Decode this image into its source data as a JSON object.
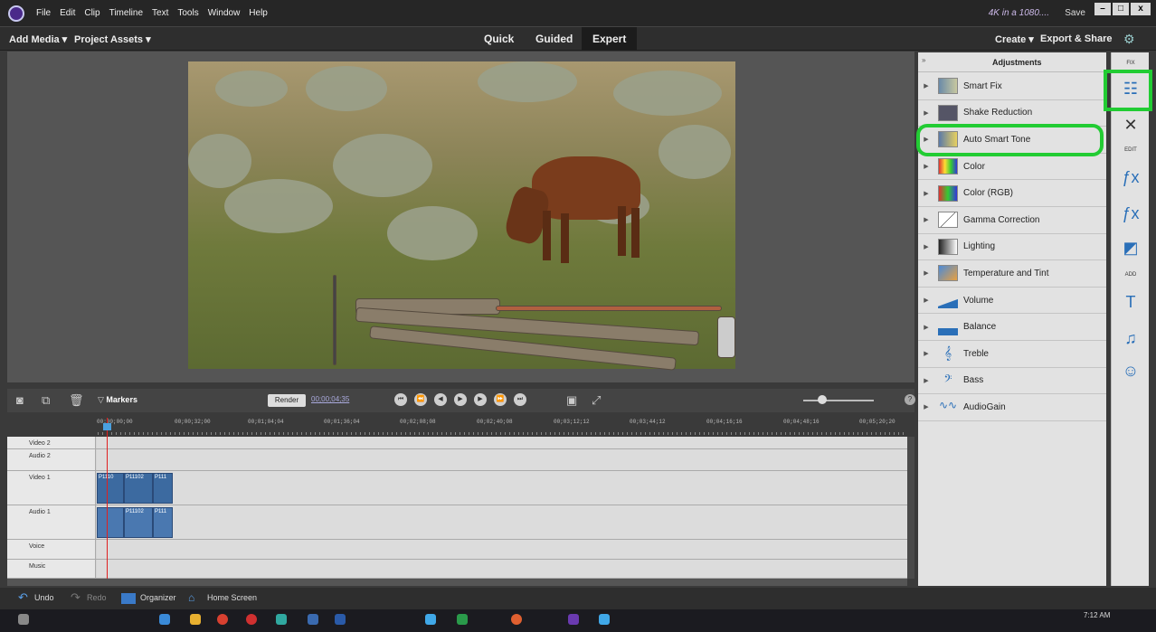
{
  "menubar": {
    "items": [
      "File",
      "Edit",
      "Clip",
      "Timeline",
      "Text",
      "Tools",
      "Window",
      "Help"
    ],
    "project": "4K in a 1080....",
    "save": "Save",
    "win_min": "–",
    "win_max": "□",
    "win_close": "x"
  },
  "toolbar": {
    "add_media": "Add Media ▾",
    "project_assets": "Project Assets ▾",
    "tabs": [
      "Quick",
      "Guided",
      "Expert"
    ],
    "create": "Create ▾",
    "export": "Export & Share"
  },
  "timeline": {
    "markers": "Markers",
    "render": "Render",
    "timecode": "00;00;04;35",
    "ruler": [
      "00;00;00;00",
      "00;00;32;00",
      "00;01;04;04",
      "00;01;36;04",
      "00;02;08;08",
      "00;02;40;08",
      "00;03;12;12",
      "00;03;44;12",
      "00;04;16;16",
      "00;04;48;16",
      "00;05;20;20"
    ],
    "tracks": [
      "Video 2",
      "Audio 2",
      "Video 1",
      "Audio 1",
      "Voice",
      "Music"
    ],
    "clips": [
      "P1110",
      "P11102",
      "P111"
    ]
  },
  "adjustments": {
    "title": "Adjustments",
    "fix_label": "FIX",
    "edit_label": "EDIT",
    "add_label": "ADD",
    "items": [
      "Smart Fix",
      "Shake Reduction",
      "Auto Smart Tone",
      "Color",
      "Color (RGB)",
      "Gamma Correction",
      "Lighting",
      "Temperature and Tint",
      "Volume",
      "Balance",
      "Treble",
      "Bass",
      "AudioGain"
    ]
  },
  "bottom": {
    "undo": "Undo",
    "redo": "Redo",
    "organizer": "Organizer",
    "home": "Home Screen"
  },
  "taskbar": {
    "time": "7:12 AM"
  },
  "colors": {
    "accent": "#22cc33",
    "panel": "#e2e2e2",
    "clip": "#3c6aa0"
  }
}
